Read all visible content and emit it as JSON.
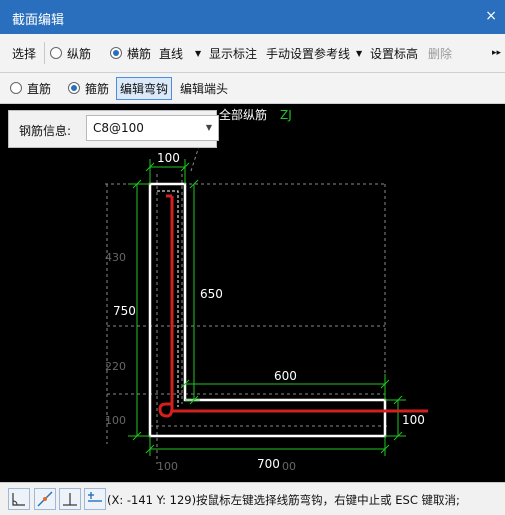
{
  "window": {
    "title": "截面编辑",
    "close": "×"
  },
  "toolbar1": {
    "select": "选择",
    "long_bar": "纵筋",
    "cross_bar": "横筋",
    "mode": "直线",
    "show_marks": "显示标注",
    "manual_ref": "手动设置参考线",
    "set_elev": "设置标高",
    "delete": "删除",
    "more": "▸▸"
  },
  "toolbar2": {
    "straight_bar": "直筋",
    "stirrup": "箍筋",
    "edit_hook": "编辑弯钩",
    "edit_end": "编辑端头"
  },
  "info": {
    "label": "钢筋信息:",
    "value": "C8@100"
  },
  "canvas": {
    "all_long": "全部纵筋",
    "zj": "ZJ",
    "dims": {
      "top": "100",
      "d430": "430",
      "d750": "750",
      "d650": "650",
      "d220": "220",
      "d600": "600",
      "d100_left": "100",
      "d100_right": "100",
      "bottom_100": "100",
      "bottom_700": "700",
      "bottom_700_ghost": "00"
    }
  },
  "status": {
    "text": "(X: -141 Y: 129)按鼠标左键选择线筋弯钩，右键中止或 ESC 键取消;"
  },
  "colors": {
    "title_bg": "#2a6fbd",
    "rebar": "#d22020",
    "dim": "#22c322",
    "outline": "#ffffff"
  }
}
